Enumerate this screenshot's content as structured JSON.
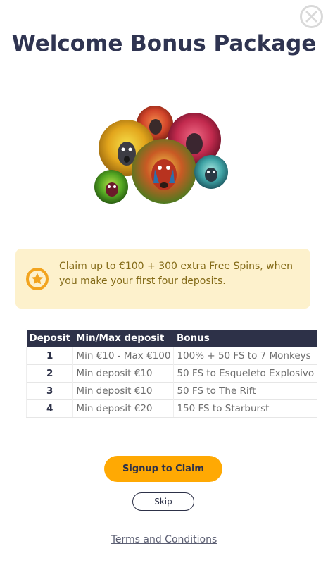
{
  "modal": {
    "title": "Welcome Bonus Package",
    "close_icon": "close-icon",
    "hero_icon": "monkeys-illustration"
  },
  "promo": {
    "icon": "star-icon",
    "text": "Claim up to €100 + 300 extra Free Spins, when you make your first four deposits."
  },
  "table": {
    "headers": [
      "Deposit",
      "Min/Max deposit",
      "Bonus"
    ],
    "rows": [
      [
        "1",
        "Min €10 - Max €100",
        "100% + 50 FS to 7 Monkeys"
      ],
      [
        "2",
        "Min deposit €10",
        "50 FS to Esqueleto Explosivo"
      ],
      [
        "3",
        "Min deposit €10",
        "50 FS to The Rift"
      ],
      [
        "4",
        "Min deposit €20",
        "150 FS to Starburst"
      ]
    ]
  },
  "actions": {
    "signup_label": "Signup to Claim",
    "skip_label": "Skip",
    "terms_label": "Terms and Conditions"
  },
  "colors": {
    "title": "#2f3451",
    "accent": "#ffa903",
    "promo_bg": "#fdf1cc",
    "promo_text": "#836a17",
    "table_header": "#2d3148"
  }
}
